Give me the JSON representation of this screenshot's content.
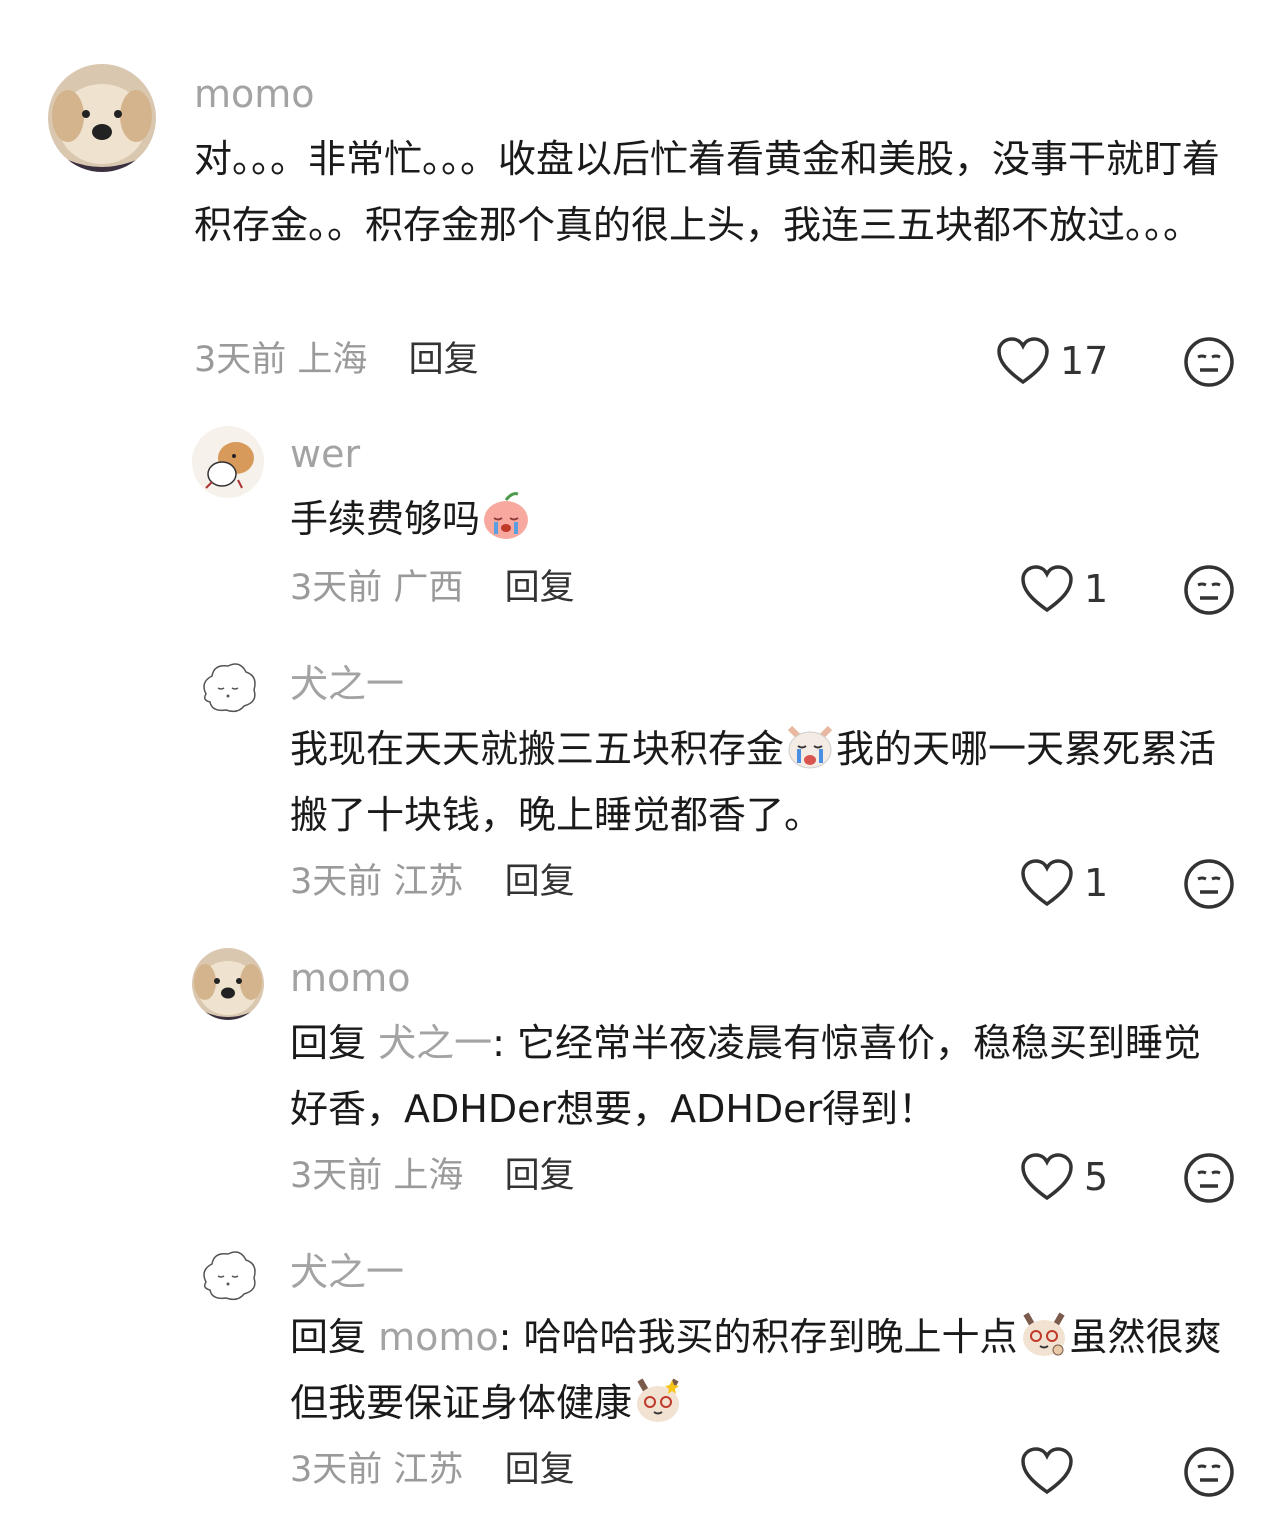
{
  "comments": [
    {
      "user": "momo",
      "text": "对。。。非常忙。。。收盘以后忙着看黄金和美股，没事干就盯着积存金。。积存金那个真的很上头，我连三五块都不放过。。。",
      "time": "3天前",
      "location": "上海",
      "reply_label": "回复",
      "likes": "17",
      "avatar": "golden-retriever-avatar"
    },
    {
      "user": "wer",
      "text": "手续费够吗",
      "time": "3天前",
      "location": "广西",
      "reply_label": "回复",
      "likes": "1",
      "avatar": "cartoon-dog-avatar",
      "emoji": "crying-peach-emoji"
    },
    {
      "user": "犬之一",
      "text_a": "我现在天天就搬三五块积存金",
      "text_b": "我的天哪一天累死累活搬了十块钱，晚上睡觉都香了。",
      "time": "3天前",
      "location": "江苏",
      "reply_label": "回复",
      "likes": "1",
      "avatar": "sketch-sheep-avatar",
      "emoji": "crying-dog-emoji"
    },
    {
      "user": "momo",
      "reply_prefix": "回复",
      "mention": "犬之一",
      "text": ": 它经常半夜凌晨有惊喜价，稳稳买到睡觉好香，ADHDer想要，ADHDer得到！",
      "time": "3天前",
      "location": "上海",
      "reply_label": "回复",
      "likes": "5",
      "avatar": "golden-retriever-avatar"
    },
    {
      "user": "犬之一",
      "reply_prefix": "回复",
      "mention": "momo",
      "text_a": ": 哈哈哈我买的积存到晚上十点",
      "text_b": "虽然很爽但我要保证身体健康",
      "time": "3天前",
      "location": "江苏",
      "reply_label": "回复",
      "likes": "",
      "avatar": "sketch-sheep-avatar",
      "emoji": "cat-emoji"
    }
  ],
  "colors": {
    "username": "#a3a3a3",
    "text": "#1a1a1a",
    "meta": "#9a9a9a"
  },
  "icons": [
    "heart-icon",
    "dislike-face-icon"
  ]
}
